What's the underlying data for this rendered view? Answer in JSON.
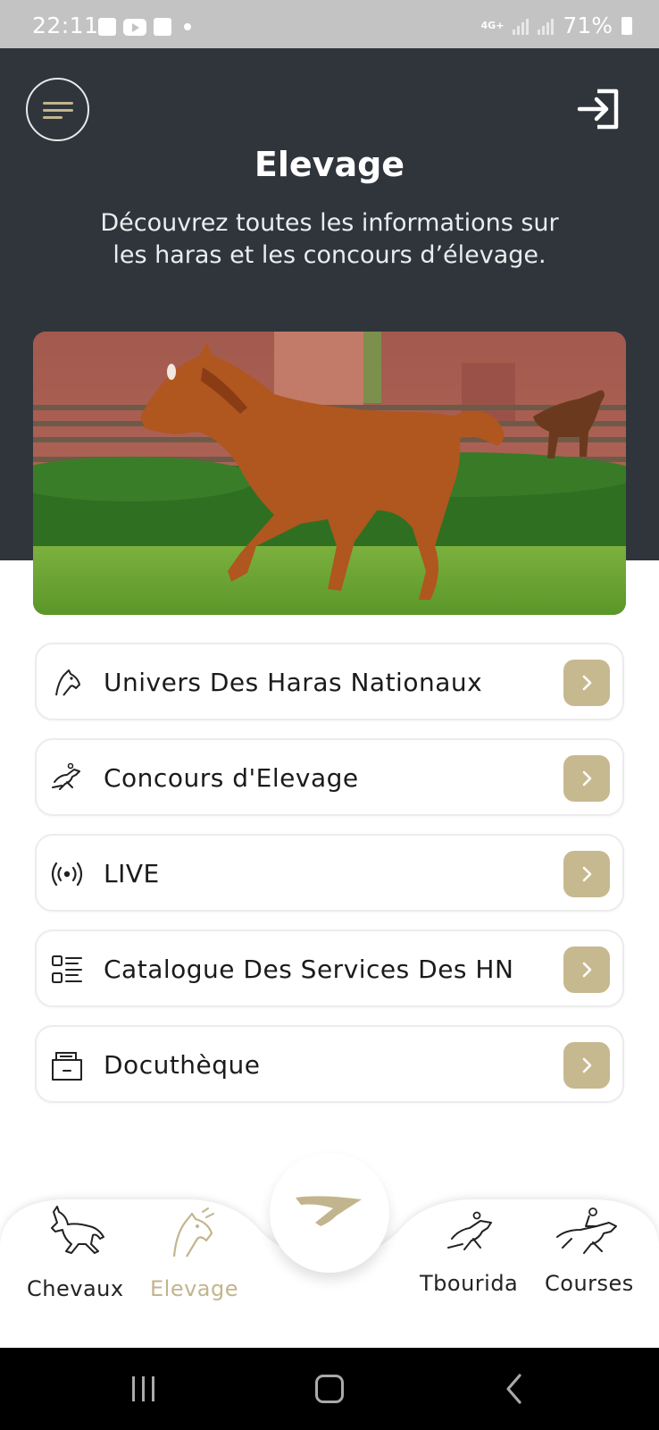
{
  "status_bar": {
    "time": "22:11",
    "network": "4G+",
    "battery": "71%",
    "icons": [
      "gallery-icon",
      "youtube-icon",
      "check-icon",
      "dot-icon",
      "signal-icon",
      "battery-icon"
    ]
  },
  "header": {
    "title": "Elevage",
    "subtitle": "Découvrez toutes les informations sur les haras et les concours d’élevage.",
    "background_color": "#30353c"
  },
  "menu": {
    "items": [
      {
        "label": "Univers Des Haras Nationaux",
        "icon": "horse-head-icon"
      },
      {
        "label": "Concours d'Elevage",
        "icon": "jumping-horse-icon"
      },
      {
        "label": "LIVE",
        "icon": "broadcast-icon"
      },
      {
        "label": "Catalogue Des Services Des HN",
        "icon": "list-icon"
      },
      {
        "label": "Docuthèque",
        "icon": "document-box-icon"
      }
    ],
    "chevron_color": "#c7b98f"
  },
  "bottom_nav": {
    "items": [
      {
        "label": "Chevaux",
        "icon": "galloping-horse-icon",
        "active": false
      },
      {
        "label": "Elevage",
        "icon": "horse-head-icon",
        "active": true
      },
      {
        "label": "Tbourida",
        "icon": "jumping-horse-icon",
        "active": false
      },
      {
        "label": "Courses",
        "icon": "racing-jockey-icon",
        "active": false
      }
    ],
    "center_icon": "brand-logo-icon",
    "active_color": "#c2b58d"
  },
  "accent_color": "#c2b58d"
}
